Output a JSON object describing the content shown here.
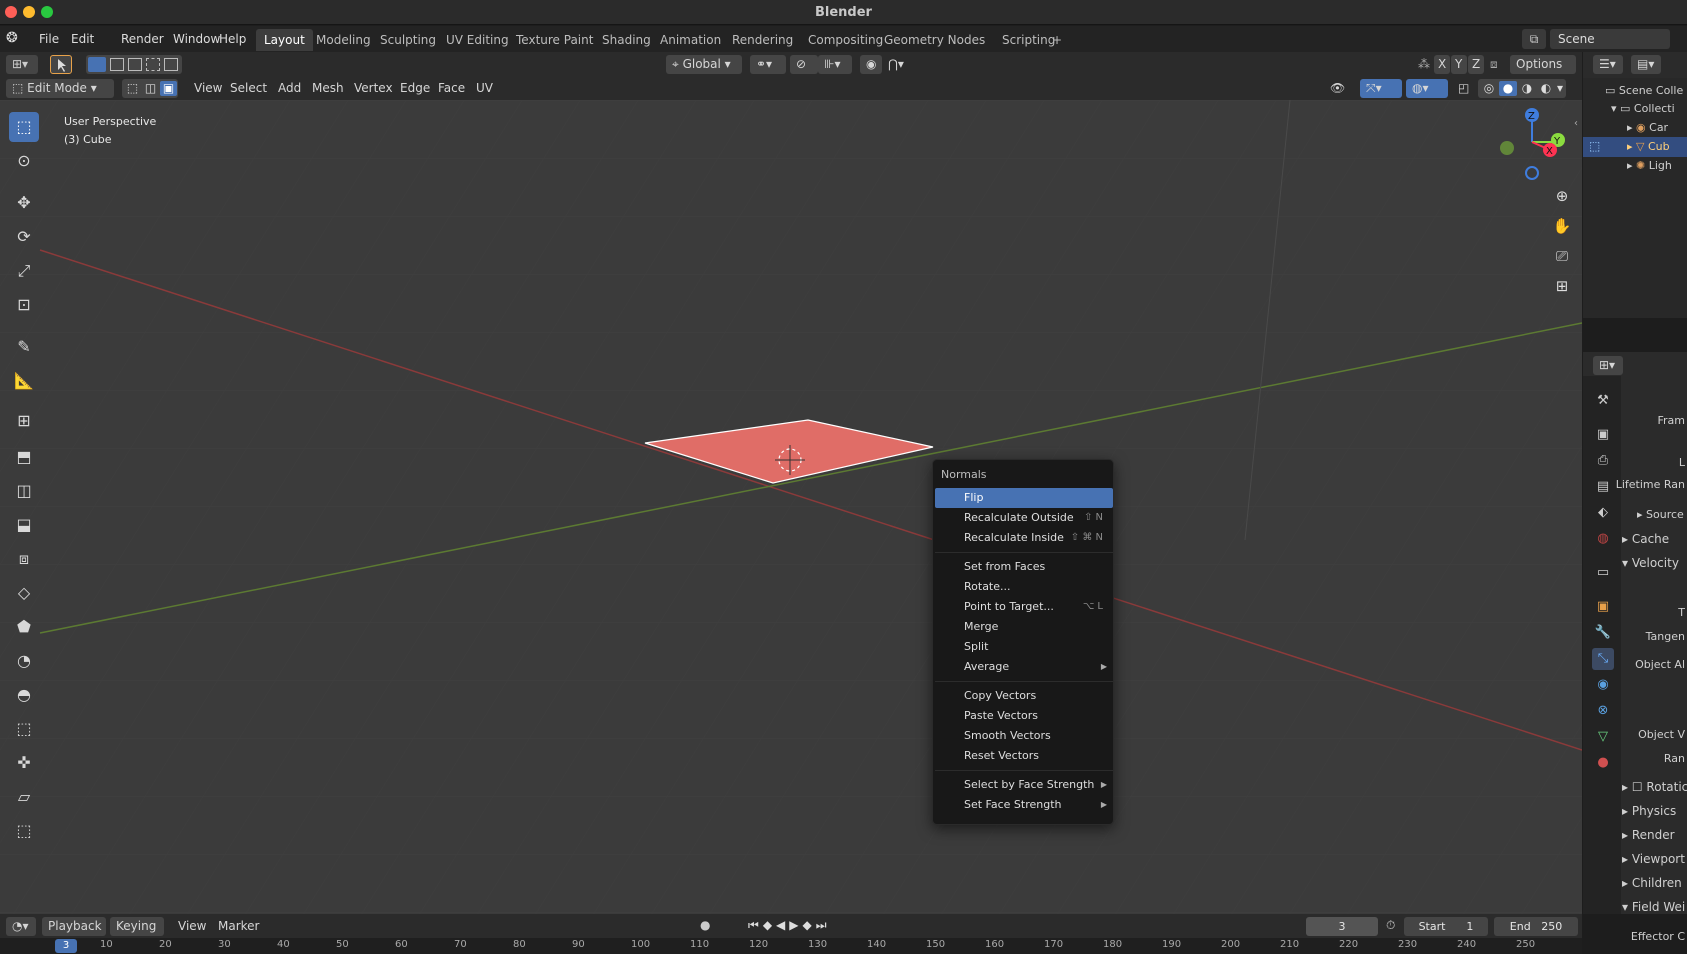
{
  "window": {
    "title": "Blender"
  },
  "menubar": {
    "items": [
      "File",
      "Edit",
      "Render",
      "Window",
      "Help"
    ]
  },
  "workspaces": {
    "tabs": [
      "Layout",
      "Modeling",
      "Sculpting",
      "UV Editing",
      "Texture Paint",
      "Shading",
      "Animation",
      "Rendering",
      "Compositing",
      "Geometry Nodes",
      "Scripting"
    ],
    "active": "Layout",
    "add_label": "+"
  },
  "scene": {
    "label": "Scene"
  },
  "header": {
    "transform_orientation": "Global",
    "options_label": "Options",
    "axes": [
      "X",
      "Y",
      "Z"
    ]
  },
  "view_header": {
    "mode": "Edit Mode",
    "menus": [
      "View",
      "Select",
      "Add",
      "Mesh",
      "Vertex",
      "Edge",
      "Face",
      "UV"
    ]
  },
  "viewport": {
    "perspective": "User Perspective",
    "object": "(3) Cube",
    "accent": "#4772b3",
    "face_color": "#e06d67"
  },
  "context_menu": {
    "title": "Normals",
    "items": [
      {
        "label": "Flip",
        "shortcut": "",
        "submenu": false,
        "active": true
      },
      {
        "label": "Recalculate Outside",
        "shortcut": "⇧ N",
        "submenu": false
      },
      {
        "label": "Recalculate Inside",
        "shortcut": "⇧ ⌘ N",
        "submenu": false
      },
      {
        "sep": true
      },
      {
        "label": "Set from Faces",
        "shortcut": "",
        "submenu": false
      },
      {
        "label": "Rotate...",
        "shortcut": "",
        "submenu": false
      },
      {
        "label": "Point to Target...",
        "shortcut": "⌥ L",
        "submenu": false
      },
      {
        "label": "Merge",
        "shortcut": "",
        "submenu": false
      },
      {
        "label": "Split",
        "shortcut": "",
        "submenu": false
      },
      {
        "label": "Average",
        "shortcut": "",
        "submenu": true
      },
      {
        "sep": true
      },
      {
        "label": "Copy Vectors",
        "shortcut": "",
        "submenu": false
      },
      {
        "label": "Paste Vectors",
        "shortcut": "",
        "submenu": false
      },
      {
        "label": "Smooth Vectors",
        "shortcut": "",
        "submenu": false
      },
      {
        "label": "Reset Vectors",
        "shortcut": "",
        "submenu": false
      },
      {
        "sep": true
      },
      {
        "label": "Select by Face Strength",
        "shortcut": "",
        "submenu": true
      },
      {
        "label": "Set Face Strength",
        "shortcut": "",
        "submenu": true
      }
    ]
  },
  "outliner": {
    "items": [
      "Scene Colle",
      "Collecti",
      "Car",
      "Cub",
      "Ligh"
    ]
  },
  "properties": {
    "labels": [
      "Fram",
      "L",
      "Lifetime Ran",
      "Source",
      "Cache",
      "Velocity",
      "T",
      "Tangen",
      "Object Al",
      "Object V",
      "Ran",
      "Rotatic",
      "Physics",
      "Render",
      "Viewport",
      "Children",
      "Field Wei",
      "Effector C"
    ]
  },
  "timeline": {
    "menus": [
      "Playback",
      "Keying",
      "View",
      "Marker"
    ],
    "current_frame": "3",
    "start_label": "Start",
    "start_value": "1",
    "end_label": "End",
    "end_value": "250",
    "ruler_current": "3",
    "ticks": [
      "10",
      "20",
      "30",
      "40",
      "50",
      "60",
      "70",
      "80",
      "90",
      "100",
      "110",
      "120",
      "130",
      "140",
      "150",
      "160",
      "170",
      "180",
      "190",
      "200",
      "210",
      "220",
      "230",
      "240",
      "250"
    ]
  }
}
